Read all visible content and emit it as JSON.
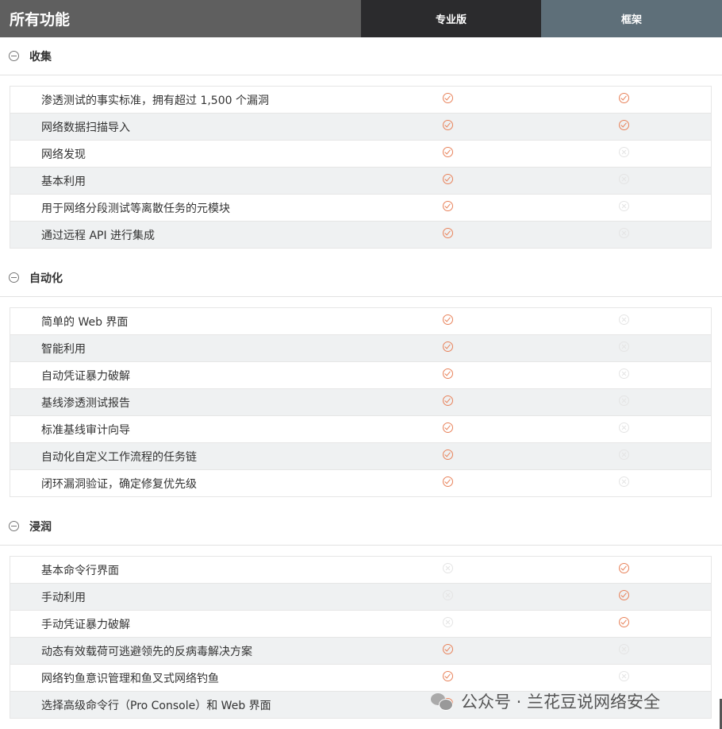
{
  "header": {
    "title": "所有功能",
    "col_pro": "专业版",
    "col_framework": "框架"
  },
  "sections": [
    {
      "title": "收集",
      "rows": [
        {
          "label": "渗透测试的事实标准，拥有超过 1,500 个漏洞",
          "pro": true,
          "framework": true
        },
        {
          "label": "网络数据扫描导入",
          "pro": true,
          "framework": true
        },
        {
          "label": "网络发现",
          "pro": true,
          "framework": false
        },
        {
          "label": "基本利用",
          "pro": true,
          "framework": false
        },
        {
          "label": "用于网络分段测试等离散任务的元模块",
          "pro": true,
          "framework": false
        },
        {
          "label": "通过远程 API 进行集成",
          "pro": true,
          "framework": false
        }
      ]
    },
    {
      "title": "自动化",
      "rows": [
        {
          "label": "简单的 Web 界面",
          "pro": true,
          "framework": false
        },
        {
          "label": "智能利用",
          "pro": true,
          "framework": false
        },
        {
          "label": "自动凭证暴力破解",
          "pro": true,
          "framework": false
        },
        {
          "label": "基线渗透测试报告",
          "pro": true,
          "framework": false
        },
        {
          "label": "标准基线审计向导",
          "pro": true,
          "framework": false
        },
        {
          "label": "自动化自定义工作流程的任务链",
          "pro": true,
          "framework": false
        },
        {
          "label": "闭环漏洞验证，确定修复优先级",
          "pro": true,
          "framework": false
        }
      ]
    },
    {
      "title": "浸润",
      "rows": [
        {
          "label": "基本命令行界面",
          "pro": false,
          "framework": true
        },
        {
          "label": "手动利用",
          "pro": false,
          "framework": true
        },
        {
          "label": "手动凭证暴力破解",
          "pro": false,
          "framework": true
        },
        {
          "label": "动态有效载荷可逃避领先的反病毒解决方案",
          "pro": true,
          "framework": false
        },
        {
          "label": "网络钓鱼意识管理和鱼叉式网络钓鱼",
          "pro": true,
          "framework": false
        },
        {
          "label": "选择高级命令行（Pro Console）和 Web 界面",
          "pro": true,
          "framework": false
        }
      ]
    }
  ],
  "watermark": {
    "icon": "wechat-icon",
    "text": "公众号 · 兰花豆说网络安全"
  },
  "colors": {
    "check": "#e8825a",
    "cross": "#e4e4e4",
    "header_title_bg": "#5f5f5f",
    "header_pro_bg": "#2b2b2d",
    "header_fw_bg": "#5e6f79"
  }
}
